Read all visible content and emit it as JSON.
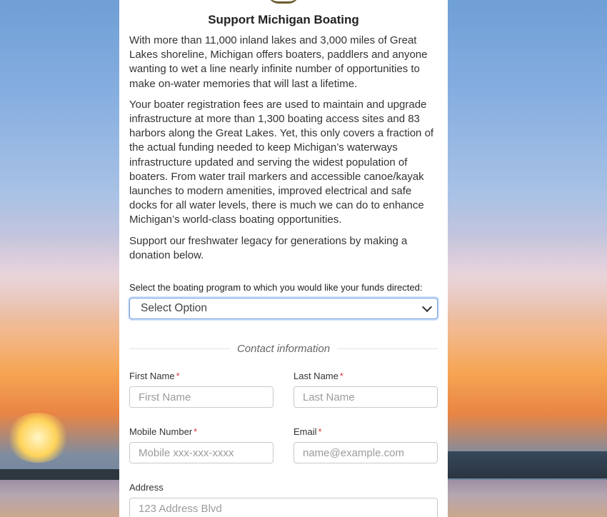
{
  "page": {
    "title": "Support Michigan Boating",
    "paragraphs": [
      "With more than 11,000 inland lakes and 3,000 miles of Great Lakes shoreline, Michigan offers boaters, paddlers and anyone wanting to wet a line nearly infinite number of opportunities to make on-water memories that will last a lifetime.",
      "Your boater registration fees are used to maintain and upgrade infrastructure at more than 1,300 boating access sites and 83 harbors along the Great Lakes. Yet, this only covers a fraction of the actual funding needed to keep Michigan’s waterways infrastructure updated and serving the widest population of boaters. From water trail markers and accessible canoe/kayak launches to modern amenities, improved electrical and safe docks for all water levels, there is much we can do to enhance Michigan’s world-class boating opportunities.",
      "Support our freshwater legacy for generations by making a donation below."
    ]
  },
  "program_select": {
    "label": "Select the boating program to which you would like your funds directed:",
    "selected_value": "Select Option"
  },
  "contact": {
    "heading": "Contact information",
    "required_marker": "*",
    "first_name": {
      "label": "First Name",
      "placeholder": "First Name"
    },
    "last_name": {
      "label": "Last Name",
      "placeholder": "Last Name"
    },
    "mobile": {
      "label": "Mobile Number",
      "placeholder": "Mobile xxx-xxx-xxxx"
    },
    "email": {
      "label": "Email",
      "placeholder": "name@example.com"
    },
    "address": {
      "label": "Address",
      "placeholder": "123 Address Blvd"
    }
  },
  "colors": {
    "required": "#d9363e",
    "select_border": "#6f9fd8",
    "panel_bg": "#ffffff"
  }
}
